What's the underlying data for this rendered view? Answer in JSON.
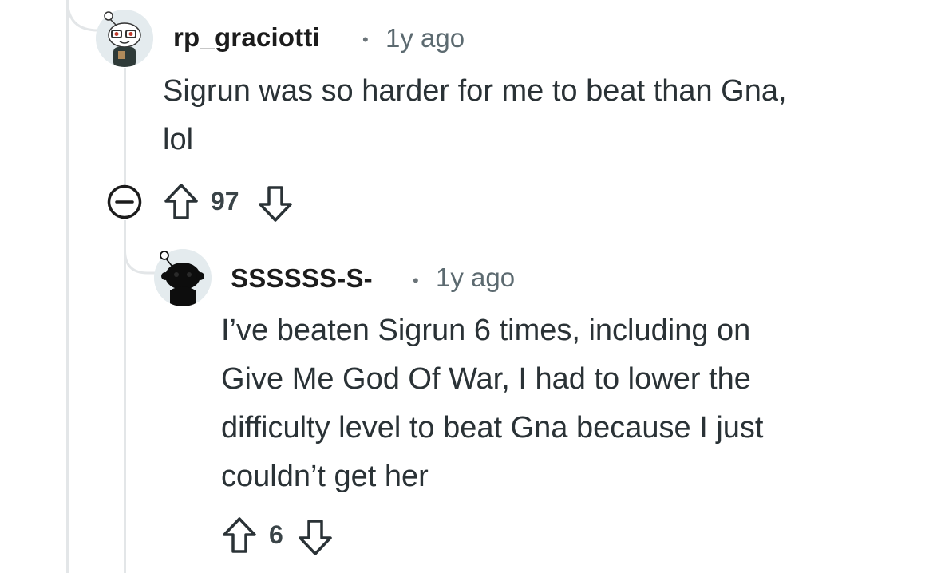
{
  "comments": [
    {
      "username": "rp_graciotti",
      "separator": "•",
      "time": "1y ago",
      "body_lines": [
        "Sigrun was so harder for me to beat than Gna,",
        "lol"
      ],
      "votes": "97"
    },
    {
      "username": "SSSSSS-S-",
      "separator": "•",
      "time": "1y ago",
      "body_lines": [
        "I’ve beaten Sigrun 6 times, including on",
        "Give Me God Of War, I had to lower the",
        "difficulty level to beat Gna because I just",
        "couldn’t get her"
      ],
      "votes": "6"
    }
  ],
  "icons": {
    "collapse": "collapse-minus-icon",
    "upvote": "upvote-arrow-icon",
    "downvote": "downvote-arrow-icon",
    "avatar": "snoo-avatar"
  }
}
